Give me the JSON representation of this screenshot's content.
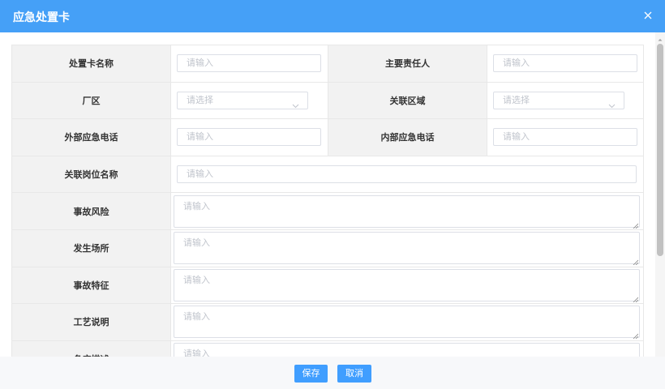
{
  "dialog": {
    "title": "应急处置卡",
    "save_label": "保存",
    "cancel_label": "取消",
    "input_placeholder": "请输入",
    "select_placeholder": "请选择"
  },
  "fields": {
    "card_name": "处置卡名称",
    "main_responsible": "主要责任人",
    "plant_area": "厂区",
    "related_area": "关联区域",
    "external_phone": "外部应急电话",
    "internal_phone": "内部应急电话",
    "related_post": "关联岗位名称",
    "accident_risk": "事故风险",
    "location": "发生场所",
    "accident_features": "事故特征",
    "process_description": "工艺说明",
    "partial_label": "条床描述"
  }
}
